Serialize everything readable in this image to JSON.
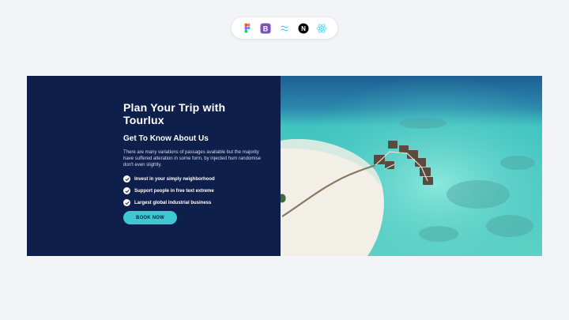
{
  "tech_icons": [
    {
      "icon": "figma-icon"
    },
    {
      "icon": "bootstrap-icon",
      "glyph": "B",
      "color": "#7952b3"
    },
    {
      "icon": "tailwind-icon",
      "color": "#38bdf8"
    },
    {
      "icon": "nextjs-icon",
      "glyph": "N",
      "color": "#000000"
    },
    {
      "icon": "react-icon",
      "color": "#61dafb"
    }
  ],
  "hero": {
    "title": "Plan Your Trip with Tourlux",
    "subtitle": "Get To Know About Us",
    "description": "There are many variations of passages available but the majority have suffered alteration in some form, by injected hum randomise don't even slightly.",
    "features": [
      "Invest in your simply neighborhood",
      "Support people in free text extreme",
      "Largest global industrial business"
    ],
    "cta_label": "BOOK NOW",
    "image": "tropical-resort-aerial-image"
  },
  "colors": {
    "page_bg": "#f3f4f7",
    "panel_bg": "#0f1f4b",
    "accent": "#3ec9d2",
    "text": "#ffffff"
  }
}
